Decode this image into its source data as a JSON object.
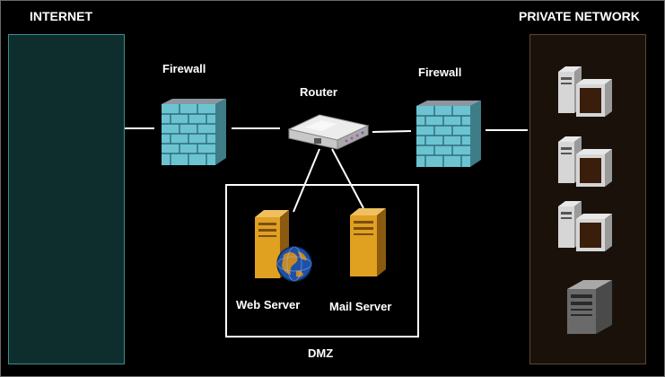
{
  "labels": {
    "internet": "INTERNET",
    "private_network": "PRIVATE NETWORK",
    "firewall_left": "Firewall",
    "firewall_right": "Firewall",
    "router": "Router",
    "web_server": "Web Server",
    "mail_server": "Mail Server",
    "dmz": "DMZ"
  },
  "colors": {
    "background": "#000000",
    "internet_zone": "#0e2e2e",
    "internet_border": "#3c8c8c",
    "private_zone": "#1a120a",
    "private_border": "#5c4630",
    "firewall_brick": "#5fb8c8",
    "server_body": "#e0a020",
    "link": "#ffffff"
  },
  "icons": {
    "firewalls": [
      "firewall-icon",
      "firewall-icon"
    ],
    "router": "router-icon",
    "dmz_servers": [
      "web-server-icon",
      "mail-server-icon"
    ],
    "private_hosts": [
      "workstation-icon",
      "workstation-icon",
      "workstation-icon",
      "server-tower-icon"
    ]
  }
}
